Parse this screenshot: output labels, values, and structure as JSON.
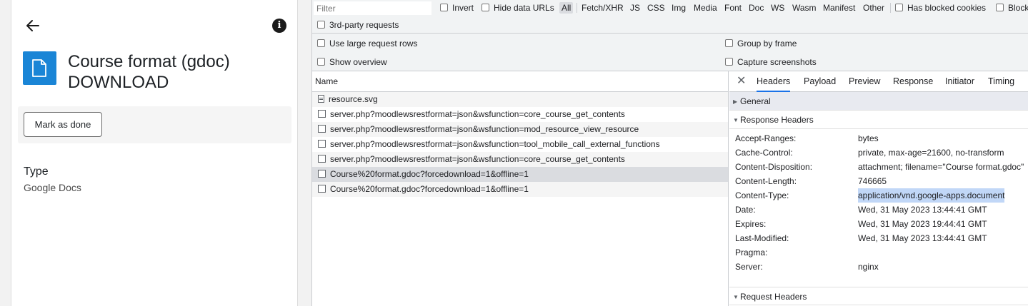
{
  "app": {
    "title_line1": "Course format (gdoc)",
    "title_line2": "DOWNLOAD",
    "info_glyph": "i",
    "mark_done_label": "Mark as done",
    "type_label": "Type",
    "type_value": "Google Docs",
    "icon_color": "#1a85d6"
  },
  "devtools": {
    "filter_placeholder": "Filter",
    "invert_label": "Invert",
    "hide_data_urls_label": "Hide data URLs",
    "type_filters": [
      "All",
      "Fetch/XHR",
      "JS",
      "CSS",
      "Img",
      "Media",
      "Font",
      "Doc",
      "WS",
      "Wasm",
      "Manifest",
      "Other"
    ],
    "has_blocked_cookies_label": "Has blocked cookies",
    "blocked_label": "Block",
    "third_party_label": "3rd-party requests",
    "settings": {
      "large_rows": "Use large request rows",
      "show_overview": "Show overview",
      "group_by_frame": "Group by frame",
      "capture_screenshots": "Capture screenshots"
    },
    "table": {
      "name_header": "Name",
      "rows": [
        {
          "name": "resource.svg",
          "icon": "doc"
        },
        {
          "name": "server.php?moodlewsrestformat=json&wsfunction=core_course_get_contents",
          "icon": "plain"
        },
        {
          "name": "server.php?moodlewsrestformat=json&wsfunction=mod_resource_view_resource",
          "icon": "plain"
        },
        {
          "name": "server.php?moodlewsrestformat=json&wsfunction=tool_mobile_call_external_functions",
          "icon": "plain"
        },
        {
          "name": "server.php?moodlewsrestformat=json&wsfunction=core_course_get_contents",
          "icon": "plain"
        },
        {
          "name": "Course%20format.gdoc?forcedownload=1&offline=1",
          "icon": "plain",
          "selected": true
        },
        {
          "name": "Course%20format.gdoc?forcedownload=1&offline=1",
          "icon": "plain"
        }
      ]
    },
    "detail": {
      "close_glyph": "✕",
      "tabs": [
        "Headers",
        "Payload",
        "Preview",
        "Response",
        "Initiator",
        "Timing"
      ],
      "general_label": "General",
      "response_headers_label": "Response Headers",
      "request_headers_label": "Request Headers",
      "response_headers": [
        {
          "name": "Accept-Ranges:",
          "value": "bytes"
        },
        {
          "name": "Cache-Control:",
          "value": "private, max-age=21600, no-transform"
        },
        {
          "name": "Content-Disposition:",
          "value": "attachment; filename=\"Course format.gdoc\""
        },
        {
          "name": "Content-Length:",
          "value": "746665"
        },
        {
          "name": "Content-Type:",
          "value": "application/vnd.google-apps.document",
          "highlight": true
        },
        {
          "name": "Date:",
          "value": "Wed, 31 May 2023 13:44:41 GMT"
        },
        {
          "name": "Expires:",
          "value": "Wed, 31 May 2023 19:44:41 GMT"
        },
        {
          "name": "Last-Modified:",
          "value": "Wed, 31 May 2023 13:44:41 GMT"
        },
        {
          "name": "Pragma:",
          "value": ""
        },
        {
          "name": "Server:",
          "value": "nginx"
        }
      ]
    }
  }
}
